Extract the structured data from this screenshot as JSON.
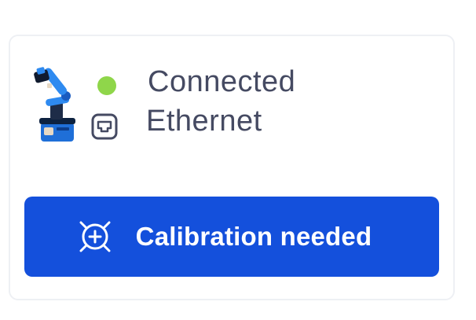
{
  "device": {
    "icon": "robot-arm-icon",
    "status_label": "Connected",
    "status_color": "#8fd64a",
    "connection_icon": "ethernet-icon",
    "connection_type": "Ethernet"
  },
  "calibration_button": {
    "icon": "calibration-target-icon",
    "label": "Calibration needed",
    "color": "#1450dc"
  }
}
